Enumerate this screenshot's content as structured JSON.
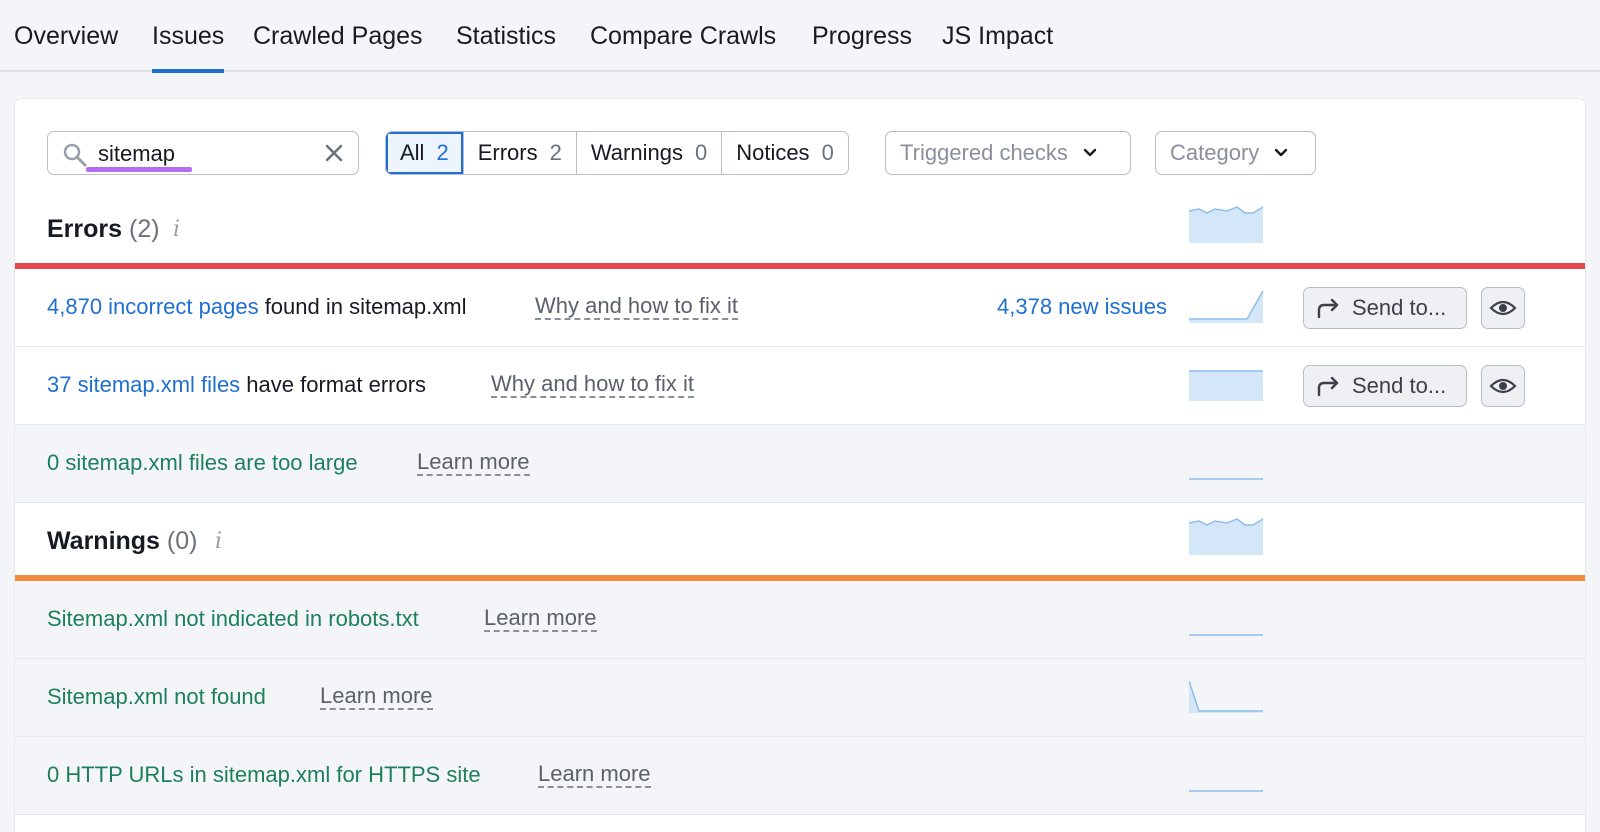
{
  "tabs": [
    {
      "label": "Overview"
    },
    {
      "label": "Issues",
      "active": true
    },
    {
      "label": "Crawled Pages"
    },
    {
      "label": "Statistics"
    },
    {
      "label": "Compare Crawls"
    },
    {
      "label": "Progress"
    },
    {
      "label": "JS Impact"
    }
  ],
  "search": {
    "value": "sitemap"
  },
  "filters": [
    {
      "label": "All",
      "count": "2",
      "active": true
    },
    {
      "label": "Errors",
      "count": "2"
    },
    {
      "label": "Warnings",
      "count": "0"
    },
    {
      "label": "Notices",
      "count": "0"
    }
  ],
  "dropdowns": {
    "triggered": "Triggered checks",
    "category": "Category"
  },
  "errors": {
    "title": "Errors",
    "count": "(2)",
    "info": "i",
    "color": "#e5484d",
    "rows": [
      {
        "link": "4,870 incorrect pages",
        "rest": " found in sitemap.xml",
        "help": "Why and how to fix it",
        "new_issues": "4,378 new issues",
        "send": "Send to..."
      },
      {
        "link": "37 sitemap.xml files",
        "rest": " have format errors",
        "help": "Why and how to fix it",
        "send": "Send to..."
      },
      {
        "text": "0 sitemap.xml files are too large",
        "help": "Learn more"
      }
    ]
  },
  "warnings": {
    "title": "Warnings",
    "count": "(0)",
    "info": "i",
    "color": "#f28a3c",
    "rows": [
      {
        "text": "Sitemap.xml not indicated in robots.txt",
        "help": "Learn more"
      },
      {
        "text": "Sitemap.xml not found",
        "help": "Learn more"
      },
      {
        "text": "0 HTTP URLs in sitemap.xml for HTTPS site",
        "help": "Learn more"
      }
    ]
  },
  "colors": {
    "accent": "#1f6fd1",
    "ok_green": "#1e7f5e",
    "spark_fill": "#d4e7f8",
    "spark_line": "#8fbdea"
  }
}
